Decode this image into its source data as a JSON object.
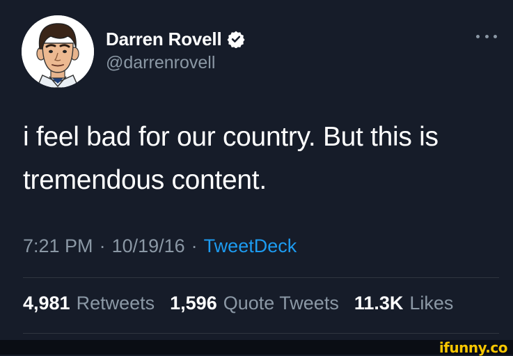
{
  "tweet": {
    "author": {
      "display_name": "Darren Rovell",
      "handle": "@darrenrovell",
      "verified": true
    },
    "text": "i feel bad for our country. But this is tremendous content.",
    "time": "7:21 PM",
    "date": "10/19/16",
    "source": "TweetDeck",
    "separator": "·",
    "stats": {
      "retweets_count": "4,981",
      "retweets_label": "Retweets",
      "quotes_count": "1,596",
      "quotes_label": "Quote Tweets",
      "likes_count": "11.3K",
      "likes_label": "Likes"
    }
  },
  "watermark": "ifunny.co",
  "colors": {
    "background": "#161c29",
    "text": "#ffffff",
    "muted": "#8b98a5",
    "link": "#1d9bf0",
    "verified": "#ffffff",
    "watermark": "#f7c600"
  },
  "icons": {
    "verified": "verified-badge-icon",
    "more": "more-options-icon"
  }
}
